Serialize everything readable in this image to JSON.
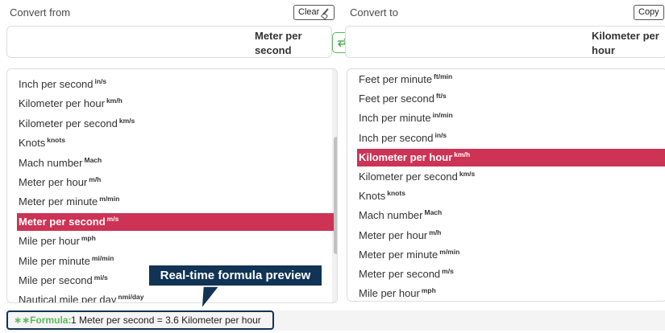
{
  "from": {
    "label": "Convert from",
    "clear_label": "Clear",
    "selected_unit": "Meter per\nsecond",
    "list": [
      {
        "name": "Inch per second",
        "abbr": "in/s"
      },
      {
        "name": "Kilometer per hour",
        "abbr": "km/h"
      },
      {
        "name": "Kilometer per second",
        "abbr": "km/s"
      },
      {
        "name": "Knots",
        "abbr": "knots"
      },
      {
        "name": "Mach number",
        "abbr": "Mach"
      },
      {
        "name": "Meter per hour",
        "abbr": "m/h"
      },
      {
        "name": "Meter per minute",
        "abbr": "m/min"
      },
      {
        "name": "Meter per second",
        "abbr": "m/s",
        "selected": true
      },
      {
        "name": "Mile per hour",
        "abbr": "mph"
      },
      {
        "name": "Mile per minute",
        "abbr": "mi/min"
      },
      {
        "name": "Mile per second",
        "abbr": "mi/s"
      },
      {
        "name": "Nautical mile per day",
        "abbr": "nmi/day"
      }
    ]
  },
  "to": {
    "label": "Convert to",
    "copy_label": "Copy",
    "selected_unit": "Kilometer per\nhour",
    "list": [
      {
        "name": "Feet per minute",
        "abbr": "ft/min"
      },
      {
        "name": "Feet per second",
        "abbr": "ft/s"
      },
      {
        "name": "Inch per minute",
        "abbr": "in/min"
      },
      {
        "name": "Inch per second",
        "abbr": "in/s"
      },
      {
        "name": "Kilometer per hour",
        "abbr": "km/h",
        "selected": true
      },
      {
        "name": "Kilometer per second",
        "abbr": "km/s"
      },
      {
        "name": "Knots",
        "abbr": "knots"
      },
      {
        "name": "Mach number",
        "abbr": "Mach"
      },
      {
        "name": "Meter per hour",
        "abbr": "m/h"
      },
      {
        "name": "Meter per minute",
        "abbr": "m/min"
      },
      {
        "name": "Meter per second",
        "abbr": "m/s"
      },
      {
        "name": "Mile per hour",
        "abbr": "mph"
      }
    ]
  },
  "swap_icon": "swap-arrows-icon",
  "formula": {
    "label": "∗∗Formula:",
    "text": "1 Meter per second = 3.6 Kilometer per hour"
  },
  "callout": "Real-time formula preview",
  "colors": {
    "selected": "#cc3355",
    "accent": "#5cb85c",
    "callout": "#113355"
  }
}
